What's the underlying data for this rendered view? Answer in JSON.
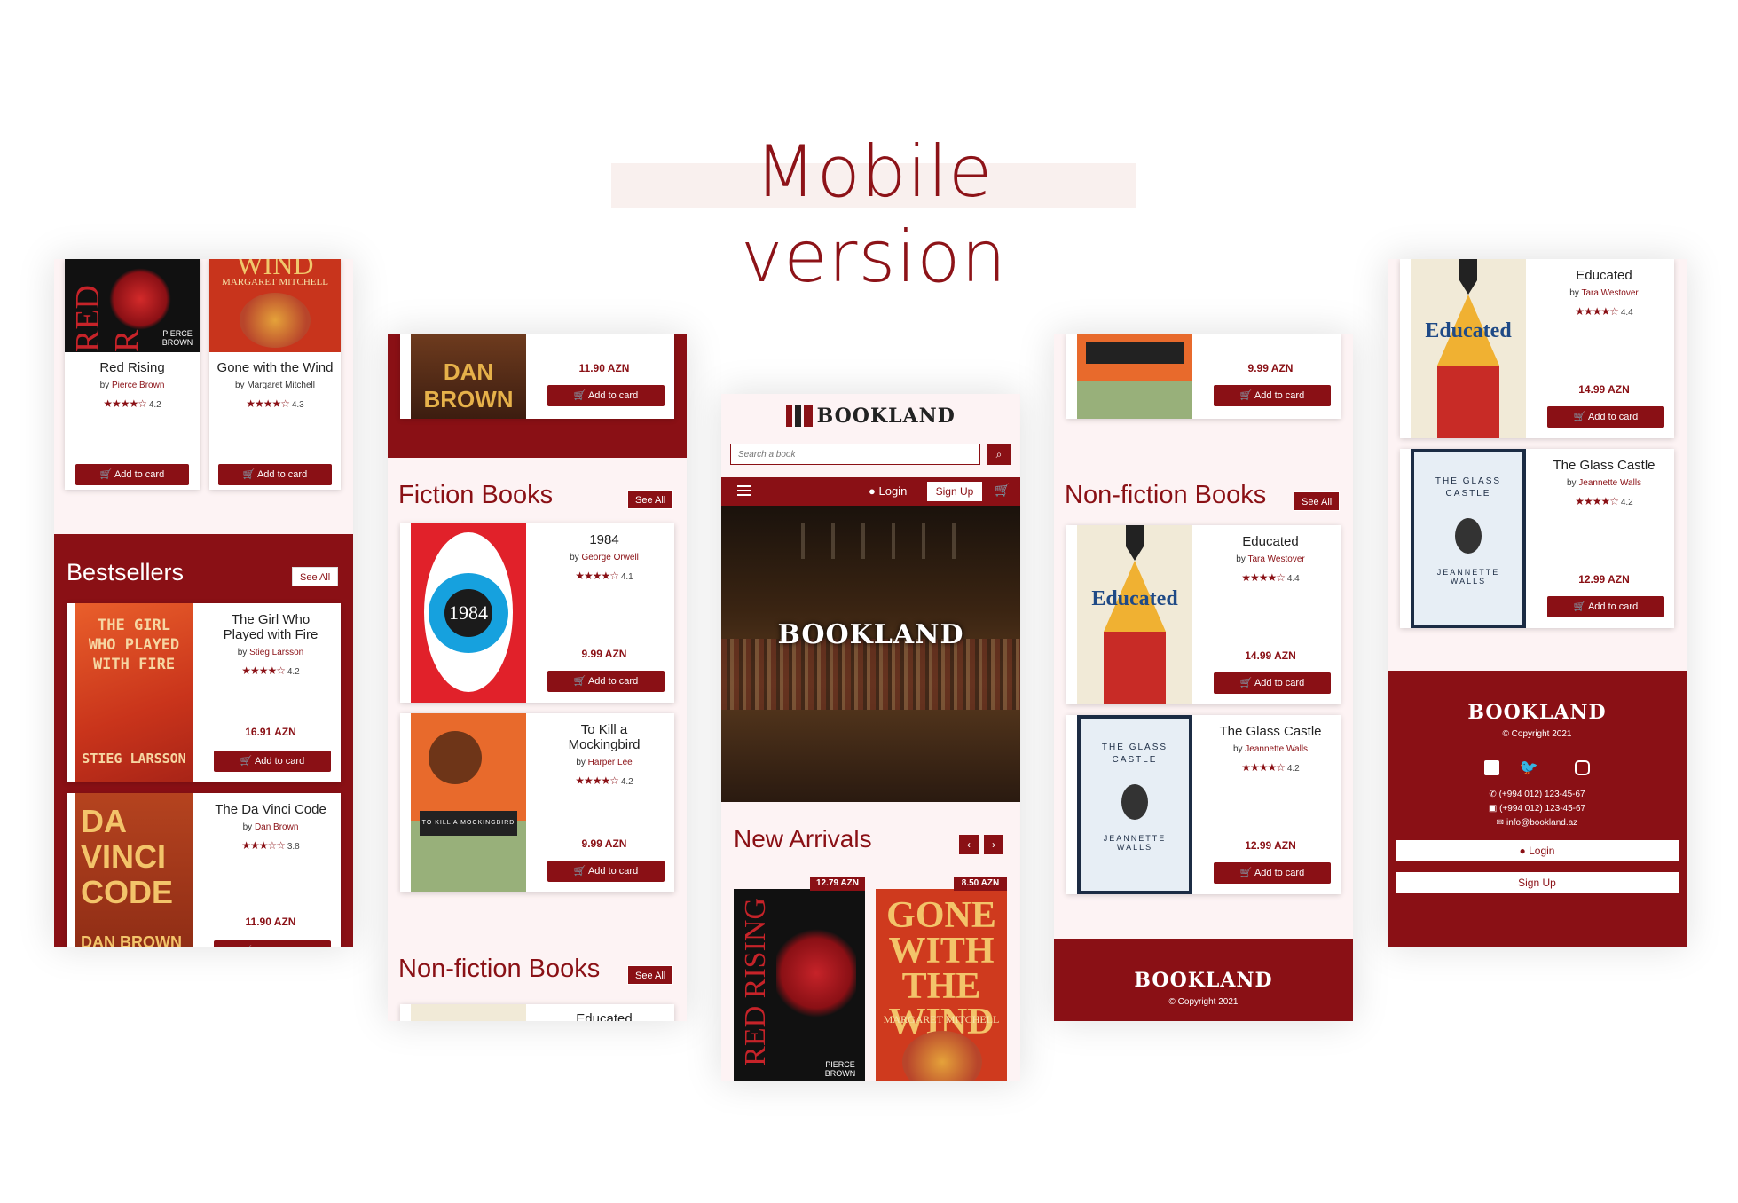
{
  "header": {
    "title": "Mobile version"
  },
  "colors": {
    "brand": "#8a1015",
    "page_bg": "#fdf3f4"
  },
  "common": {
    "add_btn": "Add to card",
    "see_all": "See All",
    "by": "by",
    "logo": "BOOKLAND",
    "copyright": "© Copyright 2021",
    "cart_icon": "cart-icon",
    "star_icon": "star-icon"
  },
  "phone1": {
    "books": [
      {
        "title": "Red Rising",
        "author": "Pierce Brown",
        "rating": "4.2",
        "cover_text": "RED R",
        "cover_author": "PIERCE BROWN"
      },
      {
        "title": "Gone with the Wind",
        "author": "Margaret Mitchell",
        "rating": "4.3",
        "cover_text": "WIND",
        "cover_author": "MARGARET MITCHELL"
      }
    ],
    "section": "Bestsellers",
    "bestsellers": [
      {
        "title": "The Girl Who Played with Fire",
        "author": "Stieg Larsson",
        "rating": "4.2",
        "price": "16.91 AZN",
        "cover_text": "THE GIRL WHO PLAYED WITH FIRE",
        "cover_author": "STIEG LARSSON"
      },
      {
        "title": "The Da Vinci Code",
        "author": "Dan Brown",
        "rating": "3.8",
        "price": "11.90 AZN",
        "cover_text": "DA VINCI CODE",
        "cover_author": "DAN BROWN"
      }
    ]
  },
  "phone2": {
    "top_price": "11.90 AZN",
    "top_cover": "DAN BROWN",
    "section": "Fiction Books",
    "books": [
      {
        "title": "1984",
        "author": "George Orwell",
        "rating": "4.1",
        "price": "9.99 AZN",
        "cover_text": "1984"
      },
      {
        "title": "To Kill a Mockingbird",
        "author": "Harper Lee",
        "rating": "4.2",
        "price": "9.99 AZN",
        "cover_text": "TO KILL A MOCKINGBIRD"
      }
    ],
    "section2": "Non-fiction Books",
    "partial_title": "Educated"
  },
  "phone3": {
    "search_placeholder": "Search a book",
    "login": "Login",
    "signup": "Sign Up",
    "hero_text": "BOOKLAND",
    "section": "New Arrivals",
    "arrivals": [
      {
        "price": "12.79 AZN",
        "cover_text": "RED RISING",
        "cover_author": "PIERCE BROWN"
      },
      {
        "price": "8.50 AZN",
        "cover_text": "GONE WITH THE WIND",
        "cover_author": "MARGARET MITCHELL"
      }
    ]
  },
  "phone4": {
    "top_price": "9.99 AZN",
    "section": "Non-fiction Books",
    "books": [
      {
        "title": "Educated",
        "author": "Tara Westover",
        "rating": "4.4",
        "price": "14.99 AZN",
        "cover_text": "Educated"
      },
      {
        "title": "The Glass Castle",
        "author": "Jeannette Walls",
        "rating": "4.2",
        "price": "12.99 AZN",
        "cover_text": "THE GLASS CASTLE"
      }
    ]
  },
  "phone5": {
    "books": [
      {
        "title": "Educated",
        "author": "Tara Westover",
        "rating": "4.4",
        "price": "14.99 AZN",
        "cover_text": "Educated"
      },
      {
        "title": "The Glass Castle",
        "author": "Jeannette Walls",
        "rating": "4.2",
        "price": "12.99 AZN",
        "cover_text": "THE GLASS CASTLE"
      }
    ],
    "phone1": "(+994 012) 123-45-67",
    "phone2": "(+994 012) 123-45-67",
    "email": "info@bookland.az",
    "login": "Login",
    "signup": "Sign Up"
  }
}
